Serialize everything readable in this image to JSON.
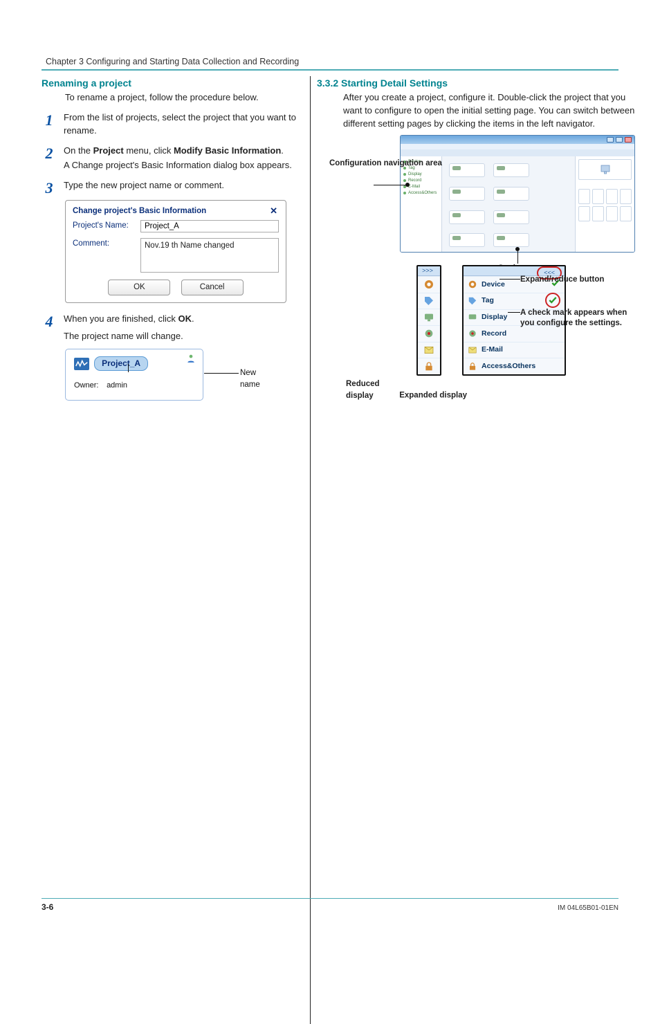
{
  "chapter_bar": "Chapter 3  Configuring and Starting Data Collection and Recording",
  "left": {
    "heading": "Renaming a project",
    "intro": "To rename a project, follow the procedure below.",
    "steps": {
      "s1_num": "1",
      "s1": "From the list of projects, select the project that you want to rename.",
      "s2_num": "2",
      "s2_a": "On the ",
      "s2_b": "Project",
      "s2_c": " menu, click ",
      "s2_d": "Modify Basic Information",
      "s2_e": ".",
      "s2_f": "A Change project's Basic Information dialog box appears.",
      "s3_num": "3",
      "s3": "Type the new project name or comment.",
      "s4_num": "4",
      "s4_a": "When you are finished, click ",
      "s4_b": "OK",
      "s4_c": ".",
      "s4_d": "The project name will change."
    },
    "dialog": {
      "title": "Change project's Basic Information",
      "close_x": "✕",
      "name_label": "Project's Name:",
      "name_value": "Project_A",
      "comment_label": "Comment:",
      "comment_value": "Nov.19 th Name changed",
      "ok": "OK",
      "cancel": "Cancel"
    },
    "projcard": {
      "name": "Project_A",
      "owner_label": "Owner:",
      "owner_value": "admin",
      "new_name_label": "New name"
    }
  },
  "right": {
    "heading": "3.3.2  Starting Detail Settings",
    "para": "After you create a project, configure it. Double-click the project that you want to configure to open the initial setting page. You can switch between different setting pages by clicking the items in the left navigator.",
    "nav_items": [
      "Device",
      "Tag",
      "Display",
      "Record",
      "E-Mail",
      "Access&Others"
    ],
    "callouts": {
      "conf_nav": "Configuration navigation area",
      "setting_page": "Setting page area",
      "expand_btn": "Expand/reduce button",
      "check_note": "A check mark appears when you configure the settings.",
      "reduced": "Reduced display",
      "expanded": "Expanded display"
    },
    "expand_toggle": "<<<"
  },
  "footer": {
    "page": "3-6",
    "docid": "IM 04L65B01-01EN"
  }
}
